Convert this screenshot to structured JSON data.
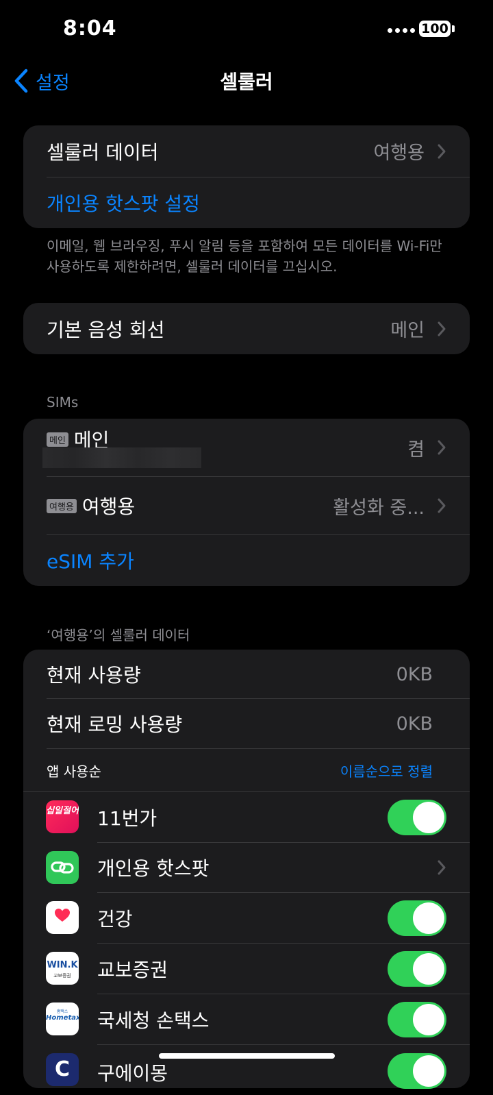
{
  "status": {
    "time": "8:04",
    "battery": "100"
  },
  "nav": {
    "back_label": "설정",
    "title": "셀룰러"
  },
  "group1": {
    "cellular_data_label": "셀룰러 데이터",
    "cellular_data_value": "여행용",
    "hotspot_label": "개인용 핫스팟 설정"
  },
  "note1": "이메일, 웹 브라우징, 푸시 알림 등을 포함하여 모든 데이터를 Wi-Fi만 사용하도록 제한하려면, 셀룰러 데이터를 끄십시오.",
  "group2": {
    "voice_label": "기본 음성 회선",
    "voice_value": "메인"
  },
  "sims": {
    "header": "SIMs",
    "main": {
      "badge": "메인",
      "label": "메인",
      "value": "켬"
    },
    "travel": {
      "badge": "여행용",
      "label": "여행용",
      "value": "활성화 중..."
    },
    "add_esim": "eSIM 추가"
  },
  "usage": {
    "header": "‘여행용’의 셀룰러 데이터",
    "current_label": "현재 사용량",
    "current_value": "0KB",
    "roaming_label": "현재 로밍 사용량",
    "roaming_value": "0KB",
    "sort_header": "앱 사용순",
    "sort_link": "이름순으로 정렬",
    "apps": [
      {
        "name": "11번가",
        "icon": "eleven-st-icon",
        "icon_text": "십일절어",
        "toggle": true
      },
      {
        "name": "개인용 핫스팟",
        "icon": "hotspot-icon",
        "toggle": null
      },
      {
        "name": "건강",
        "icon": "health-heart-icon",
        "toggle": true
      },
      {
        "name": "교보증권",
        "icon": "kyobo-wink-icon",
        "icon_text": "WIN.K",
        "icon_sub": "교보증권",
        "toggle": true
      },
      {
        "name": "국세청 손택스",
        "icon": "hometax-icon",
        "icon_text": "Hometax",
        "icon_sub": "홈택스",
        "toggle": true
      },
      {
        "name": "구에이몽",
        "icon": "app-c-icon",
        "icon_text": "C",
        "toggle": true
      }
    ]
  },
  "colors": {
    "accent": "#0a84ff",
    "toggle_on": "#30d158",
    "group_bg": "#1c1c1e"
  }
}
